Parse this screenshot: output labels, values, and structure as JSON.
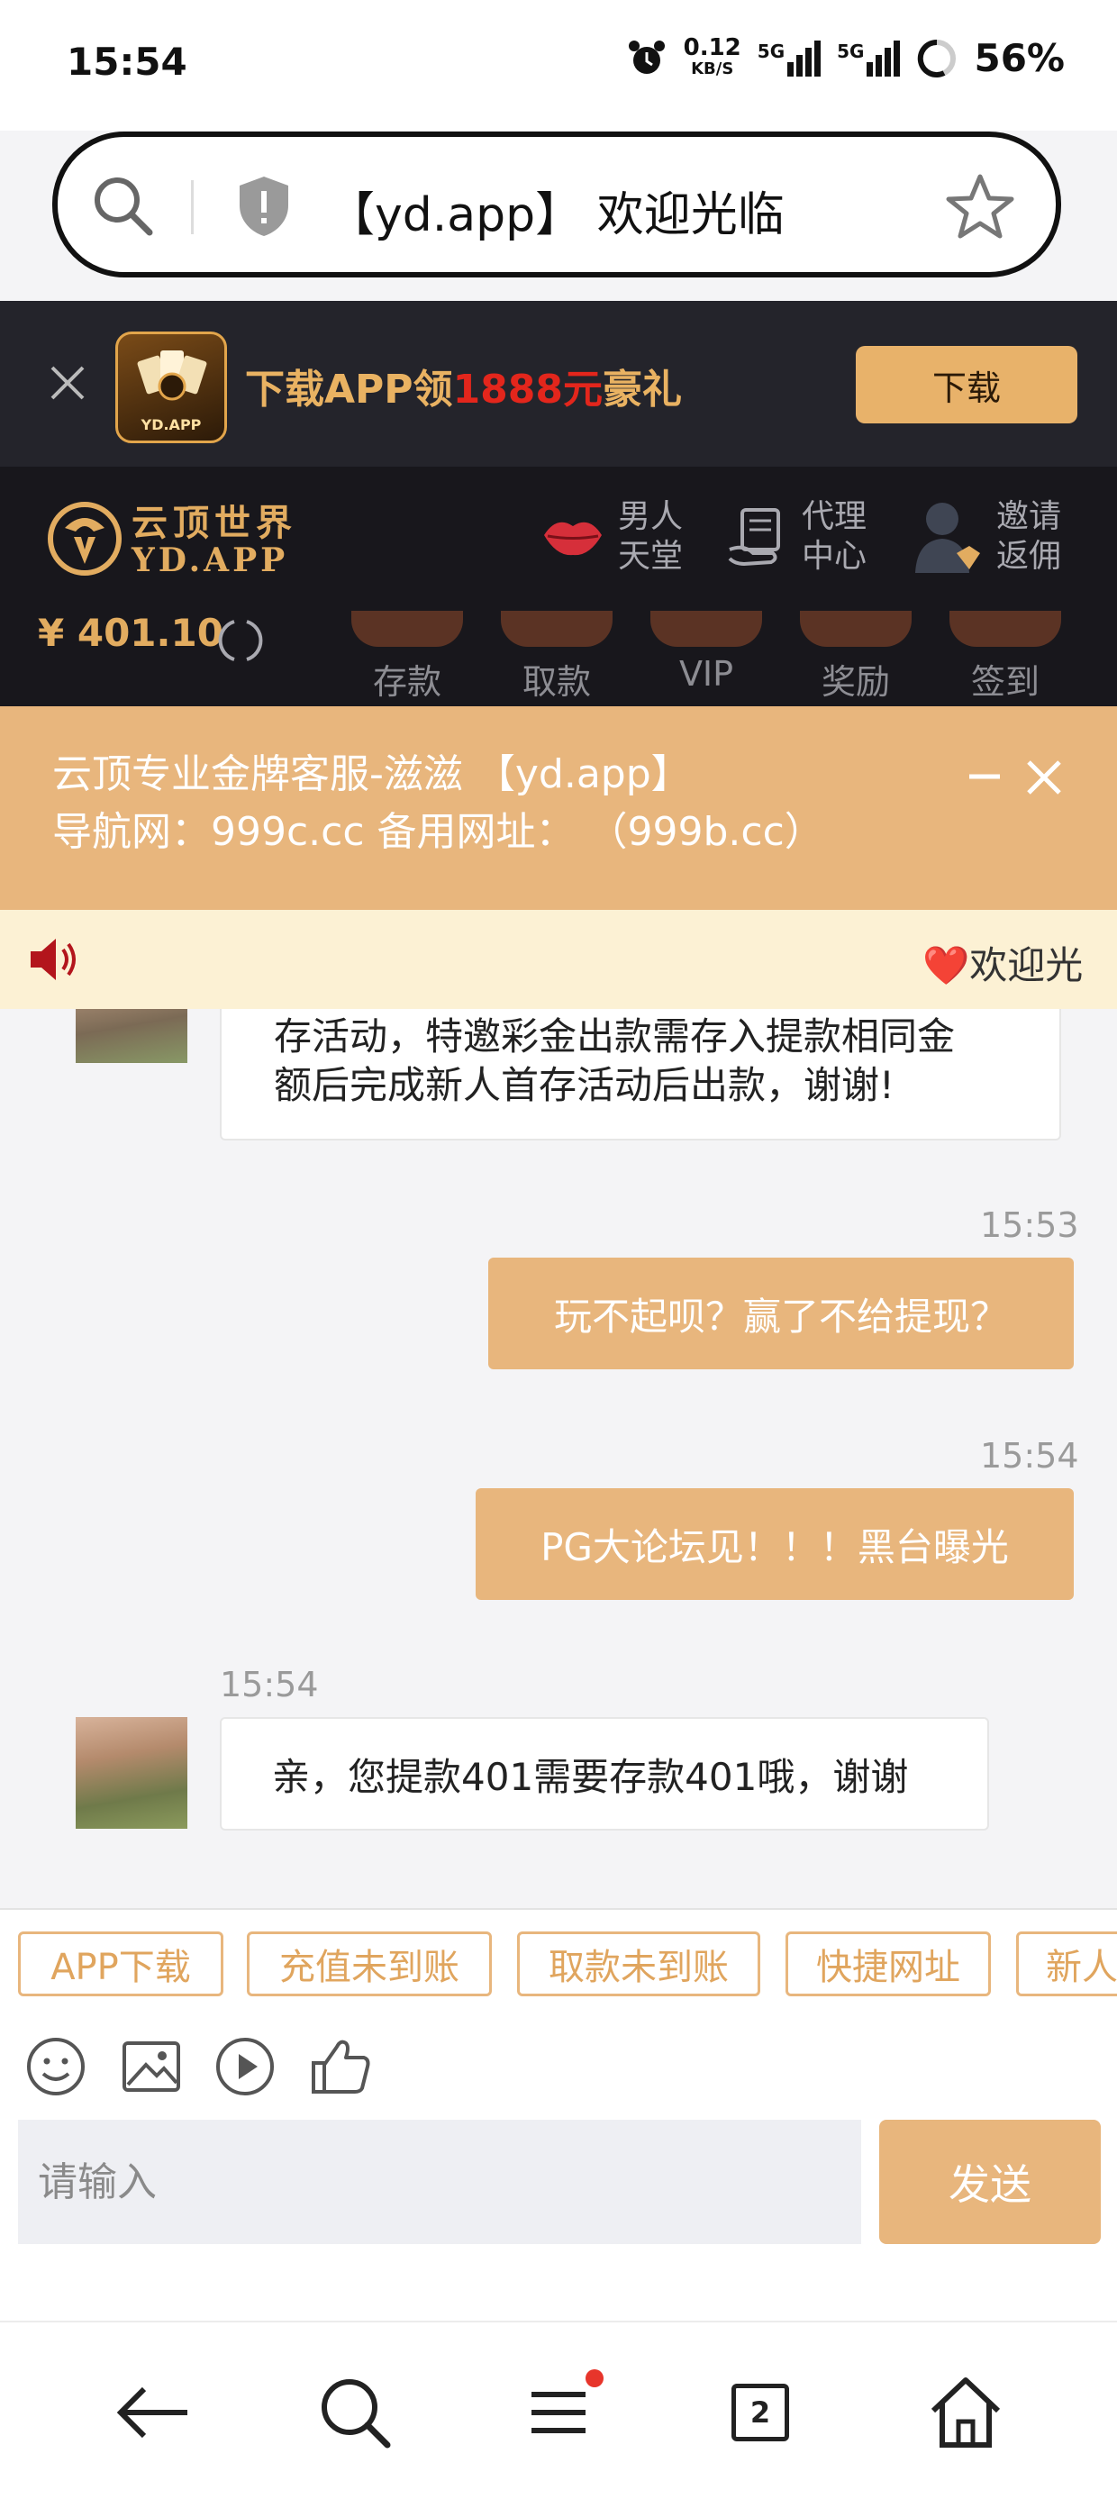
{
  "status_bar": {
    "time": "15:54",
    "net_speed": "0.12",
    "net_unit": "KB/S",
    "signal_1": "5G",
    "signal_2": "5G",
    "battery": "56%"
  },
  "browser": {
    "url_title": "【yd.app】 欢迎光临"
  },
  "download_banner": {
    "text_before": "下载APP领",
    "text_highlight": "1888元",
    "text_after": "豪礼",
    "app_icon_label": "YD.APP",
    "button_label": "下载"
  },
  "site_header": {
    "logo_cn": "云顶世界",
    "logo_en": "YD.APP",
    "links": [
      {
        "line1": "男人",
        "line2": "天堂"
      },
      {
        "line1": "代理",
        "line2": "中心"
      },
      {
        "line1": "邀请",
        "line2": "返佣"
      }
    ],
    "balance": "¥ 401.10",
    "tabs": [
      "存款",
      "取款",
      "VIP",
      "奖励",
      "签到"
    ]
  },
  "notice": {
    "line1": "云顶专业金牌客服-滋滋 【yd.app】",
    "line2": "导航网：999c.cc 备用网址： （999b.cc）"
  },
  "marquee": {
    "text": "❤️欢迎光"
  },
  "chat": {
    "partial_message": [
      "存活动，特邀彩金出款需存入提款相同金",
      "额后完成新人首存活动后出款，谢谢!"
    ],
    "messages": [
      {
        "time": "15:53",
        "text": "玩不起呗？赢了不给提现？"
      },
      {
        "time": "15:54",
        "text": "PG大论坛见！！！黑台曝光"
      },
      {
        "time": "15:54",
        "text": "亲，您提款401需要存款401哦，谢谢"
      }
    ]
  },
  "quick_replies": [
    "APP下载",
    "充值未到账",
    "取款未到账",
    "快捷网址",
    "新人"
  ],
  "composer": {
    "placeholder": "请输入",
    "send_label": "发送"
  },
  "nav": {
    "tab_count": "2"
  },
  "colors": {
    "accent": "#e8b67d",
    "gold": "#e2ac60",
    "dark": "#18171c",
    "red": "#e3261c"
  }
}
